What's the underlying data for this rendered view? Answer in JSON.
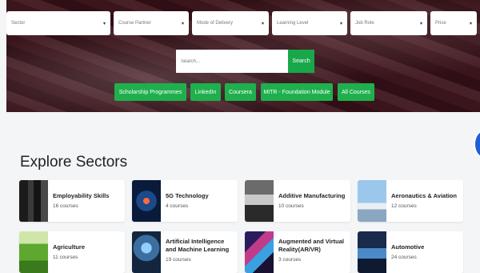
{
  "filters": [
    {
      "label": "Sector"
    },
    {
      "label": "Course Partner"
    },
    {
      "label": "Mode of Delivery"
    },
    {
      "label": "Learning Level"
    },
    {
      "label": "Job Role"
    },
    {
      "label": "Price"
    }
  ],
  "search": {
    "placeholder": "Search...",
    "button_label": "Search"
  },
  "nav_pills": [
    {
      "label": "Scholarship Programmes"
    },
    {
      "label": "LinkedIn"
    },
    {
      "label": "Coursera"
    },
    {
      "label": "MITR - Foundation Module"
    },
    {
      "label": "All Courses"
    }
  ],
  "section_title": "Explore Sectors",
  "sectors": [
    {
      "name": "Employability Skills",
      "count": "16 courses",
      "thumb": "employability-image"
    },
    {
      "name": "5G Technology",
      "count": "4 courses",
      "thumb": "5g-image"
    },
    {
      "name": "Additive Manufacturing",
      "count": "10 courses",
      "thumb": "3d-printer-image"
    },
    {
      "name": "Aeronautics & Aviation",
      "count": "12 courses",
      "thumb": "airplane-image"
    },
    {
      "name": "Agriculture",
      "count": "11 courses",
      "thumb": "agriculture-image"
    },
    {
      "name": "Artificial Intelligence and Machine Learning",
      "count": "19 courses",
      "thumb": "ai-robot-image"
    },
    {
      "name": "Augmented and Virtual Reality(AR/VR)",
      "count": "3 courses",
      "thumb": "vr-image"
    },
    {
      "name": "Automotive",
      "count": "24 courses",
      "thumb": "car-image"
    }
  ]
}
